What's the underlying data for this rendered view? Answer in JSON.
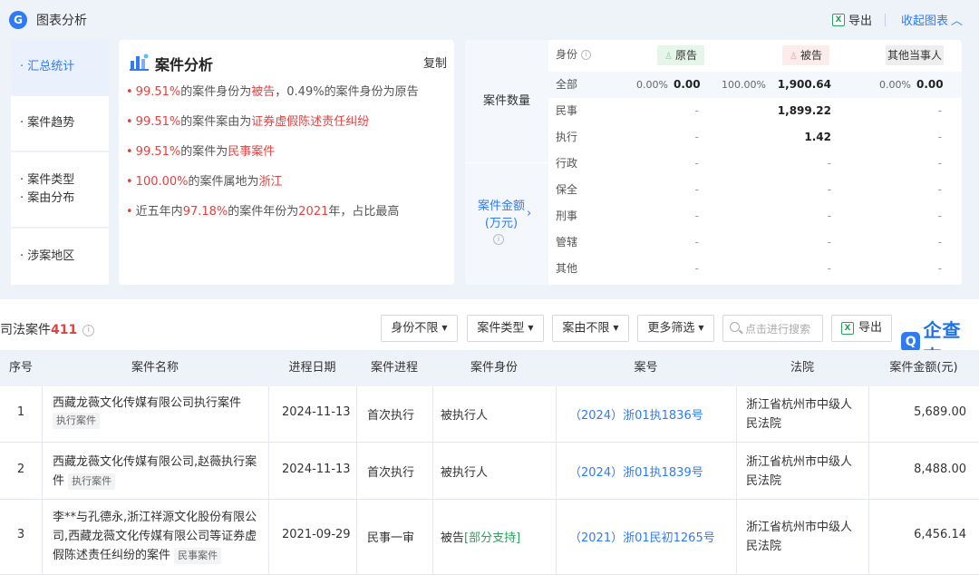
{
  "panel": {
    "logo": "G",
    "title": "图表分析",
    "export_label": "导出",
    "collapse_label": "收起图表",
    "nav": [
      {
        "label": "汇总统计",
        "active": true
      },
      {
        "label": "案件趋势"
      },
      {
        "label": "案件类型",
        "label2": "案由分布"
      },
      {
        "label": "涉案地区"
      }
    ],
    "analysis": {
      "title": "案件分析",
      "copy_label": "复制",
      "bullets": [
        {
          "p1": "99.51%",
          "p2": "的案件身份为",
          "p3": "被告",
          "p4": "，0.49%的案件身份为原告"
        },
        {
          "p1": "99.51%",
          "p2": "的案件案由为",
          "p3": "证券虚假陈述责任纠纷",
          "p4": ""
        },
        {
          "p1": "99.51%",
          "p2": "的案件为",
          "p3": "民事案件",
          "p4": ""
        },
        {
          "p1": "100.00%",
          "p2": "的案件属地为",
          "p3": "浙江",
          "p4": ""
        },
        {
          "p0": "近五年内",
          "p1": "97.18%",
          "p2": "的案件年份为",
          "p3": "2021",
          "p4": "年，占比最高"
        }
      ]
    },
    "stats": {
      "left_label_1": "案件数量",
      "left_label_2a": "案件金额",
      "left_label_2b": "(万元)",
      "identity_label": "身份",
      "plaintiff_label": "原告",
      "defendant_label": "被告",
      "other_label": "其他当事人",
      "rows": [
        {
          "label": "全部",
          "p_pct": "0.00%",
          "p_val": "0.00",
          "d_pct": "100.00%",
          "d_val": "1,900.64",
          "o_pct": "0.00%",
          "o_val": "0.00"
        },
        {
          "label": "民事",
          "p_val": "-",
          "d_val": "1,899.22",
          "o_val": "-"
        },
        {
          "label": "执行",
          "p_val": "-",
          "d_val": "1.42",
          "o_val": "-"
        },
        {
          "label": "行政",
          "p_val": "-",
          "d_val": "-",
          "o_val": "-"
        },
        {
          "label": "保全",
          "p_val": "-",
          "d_val": "-",
          "o_val": "-"
        },
        {
          "label": "刑事",
          "p_val": "-",
          "d_val": "-",
          "o_val": "-"
        },
        {
          "label": "管辖",
          "p_val": "-",
          "d_val": "-",
          "o_val": "-"
        },
        {
          "label": "其他",
          "p_val": "-",
          "d_val": "-",
          "o_val": "-"
        }
      ]
    }
  },
  "list": {
    "title": "司法案件",
    "count": "411",
    "filters": [
      "身份不限",
      "案件类型",
      "案由不限",
      "更多筛选"
    ],
    "search_placeholder": "点击进行搜索",
    "export_label": "导出",
    "brand_logo": "Q",
    "brand_name": "企查查",
    "columns": [
      "序号",
      "案件名称",
      "进程日期",
      "案件进程",
      "案件身份",
      "案号",
      "法院",
      "案件金额(元)"
    ],
    "rows": [
      {
        "no": "1",
        "name": "西藏龙薇文化传媒有限公司执行案件",
        "name_tag": "执行案件",
        "date": "2024-11-13",
        "progress": "首次执行",
        "identity": "被执行人",
        "identity_extra": "",
        "case_no": "（2024）浙01执1836号",
        "court": "浙江省杭州市中级人民法院",
        "amount": "5,689.00"
      },
      {
        "no": "2",
        "name": "西藏龙薇文化传媒有限公司,赵薇执行案件",
        "name_tag": "执行案件",
        "date": "2024-11-13",
        "progress": "首次执行",
        "identity": "被执行人",
        "identity_extra": "",
        "case_no": "（2024）浙01执1839号",
        "court": "浙江省杭州市中级人民法院",
        "amount": "8,488.00"
      },
      {
        "no": "3",
        "name": "李**与孔德永,浙江祥源文化股份有限公司,西藏龙薇文化传媒有限公司等证券虚假陈述责任纠纷的案件",
        "name_tag": "民事案件",
        "date": "2021-09-29",
        "progress": "民事一审",
        "identity": "被告",
        "identity_extra": "[部分支持]",
        "case_no": "（2021）浙01民初1265号",
        "court": "浙江省杭州市中级人民法院",
        "amount": "6,456.14"
      }
    ]
  }
}
